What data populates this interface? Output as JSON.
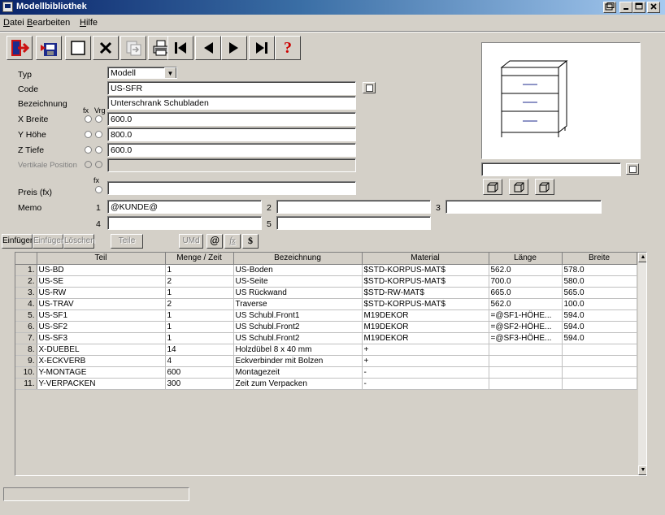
{
  "window": {
    "title": "Modellbibliothek",
    "controls": [
      "restore-icon",
      "minimize-icon",
      "maximize-icon",
      "close-icon"
    ]
  },
  "menu": [
    {
      "label": "Datei",
      "key": "D"
    },
    {
      "label": "Bearbeiten",
      "key": "B"
    },
    {
      "label": "Hilfe",
      "key": "H"
    }
  ],
  "toolbar": {
    "icons": [
      "exit-icon",
      "save-icon",
      "new-icon",
      "delete-icon",
      "copy-icon",
      "print-icon",
      "first-record-icon",
      "previous-record-icon",
      "next-record-icon",
      "last-record-icon",
      "help-icon"
    ],
    "help_label": "?"
  },
  "form": {
    "typ_label": "Typ",
    "typ_value": "Modell",
    "code_label": "Code",
    "code_value": "US-SFR",
    "bezeichnung_label": "Bezeichnung",
    "bezeichnung_value": "Unterschrank Schubladen",
    "fx_label": "fx",
    "vrg_label": "Vrg",
    "breite_label": "X Breite",
    "breite_value": "600.0",
    "hoehe_label": "Y Höhe",
    "hoehe_value": "800.0",
    "tiefe_label": "Z Tiefe",
    "tiefe_value": "600.0",
    "vertikale_label": "Vertikale Position",
    "vertikale_value": "",
    "preis_label": "Preis (fx)",
    "preis_fx_label": "fx",
    "preis_value": "",
    "memo_label": "Memo",
    "memo": [
      {
        "num": "1",
        "value": "@KUNDE@"
      },
      {
        "num": "2",
        "value": ""
      },
      {
        "num": "3",
        "value": ""
      },
      {
        "num": "4",
        "value": ""
      },
      {
        "num": "5",
        "value": ""
      }
    ]
  },
  "preview": {
    "caption_value": "",
    "view_icons": [
      "view-front-icon",
      "view-iso-left-icon",
      "view-iso-right-icon"
    ]
  },
  "actions": {
    "einfuegen": "Einfügen",
    "einfuegen2": "Einfügen",
    "loeschen": "Löschen",
    "teile": "Teile",
    "umd": "UMd",
    "at": "@",
    "fx": "fx",
    "dollar": "$"
  },
  "table": {
    "columns": [
      "",
      "Teil",
      "Menge / Zeit",
      "Bezeichnung",
      "Material",
      "Länge",
      "Breite"
    ],
    "rows": [
      [
        "1.",
        "US-BD",
        "1",
        "US-Boden",
        "$STD-KORPUS-MAT$",
        "562.0",
        "578.0"
      ],
      [
        "2.",
        "US-SE",
        "2",
        "US-Seite",
        "$STD-KORPUS-MAT$",
        "700.0",
        "580.0"
      ],
      [
        "3.",
        "US-RW",
        "1",
        "US Rückwand",
        "$STD-RW-MAT$",
        "665.0",
        "565.0"
      ],
      [
        "4.",
        "US-TRAV",
        "2",
        "Traverse",
        "$STD-KORPUS-MAT$",
        "562.0",
        "100.0"
      ],
      [
        "5.",
        "US-SF1",
        "1",
        "US Schubl.Front1",
        "M19DEKOR",
        "=@SF1-HÖHE...",
        "594.0"
      ],
      [
        "6.",
        "US-SF2",
        "1",
        "US Schubl.Front2",
        "M19DEKOR",
        "=@SF2-HÖHE...",
        "594.0"
      ],
      [
        "7.",
        "US-SF3",
        "1",
        "US Schubl.Front2",
        "M19DEKOR",
        "=@SF3-HÖHE...",
        "594.0"
      ],
      [
        "8.",
        "X-DUEBEL",
        "14",
        "Holzdübel 8 x 40 mm",
        "+",
        "",
        ""
      ],
      [
        "9.",
        "X-ECKVERB",
        "4",
        "Eckverbinder mit Bolzen",
        "+",
        "",
        ""
      ],
      [
        "10.",
        "Y-MONTAGE",
        "600",
        "Montagezeit",
        "-",
        "",
        ""
      ],
      [
        "11.",
        "Y-VERPACKEN",
        "300",
        "Zeit zum Verpacken",
        "-",
        "",
        ""
      ]
    ]
  },
  "status": {
    "text": ""
  },
  "colors": {
    "titlebar_start": "#0a246a",
    "titlebar_end": "#a6caf0",
    "face": "#d4d0c8",
    "exit_red": "#cc1111",
    "help_red": "#cc0000"
  }
}
